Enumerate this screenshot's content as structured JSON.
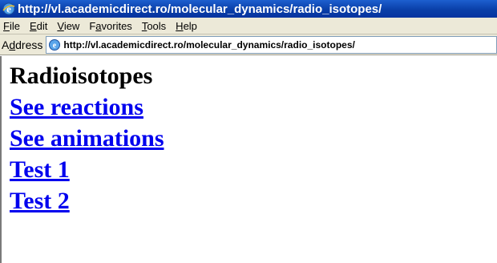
{
  "window": {
    "title": "http://vl.academicdirect.ro/molecular_dynamics/radio_isotopes/"
  },
  "menu": {
    "items": [
      {
        "accel": "F",
        "rest": "ile"
      },
      {
        "accel": "E",
        "rest": "dit"
      },
      {
        "accel": "V",
        "rest": "iew"
      },
      {
        "pre": "F",
        "accel": "a",
        "rest": "vorites"
      },
      {
        "accel": "T",
        "rest": "ools"
      },
      {
        "accel": "H",
        "rest": "elp"
      }
    ]
  },
  "address": {
    "label_pre": "A",
    "label_accel": "d",
    "label_rest": "dress",
    "url": "http://vl.academicdirect.ro/molecular_dynamics/radio_isotopes/"
  },
  "page": {
    "heading": "Radioisotopes",
    "links": [
      "See reactions",
      "See animations",
      "Test 1",
      "Test 2"
    ]
  },
  "icons": [
    "ie-icon",
    "page-icon"
  ]
}
